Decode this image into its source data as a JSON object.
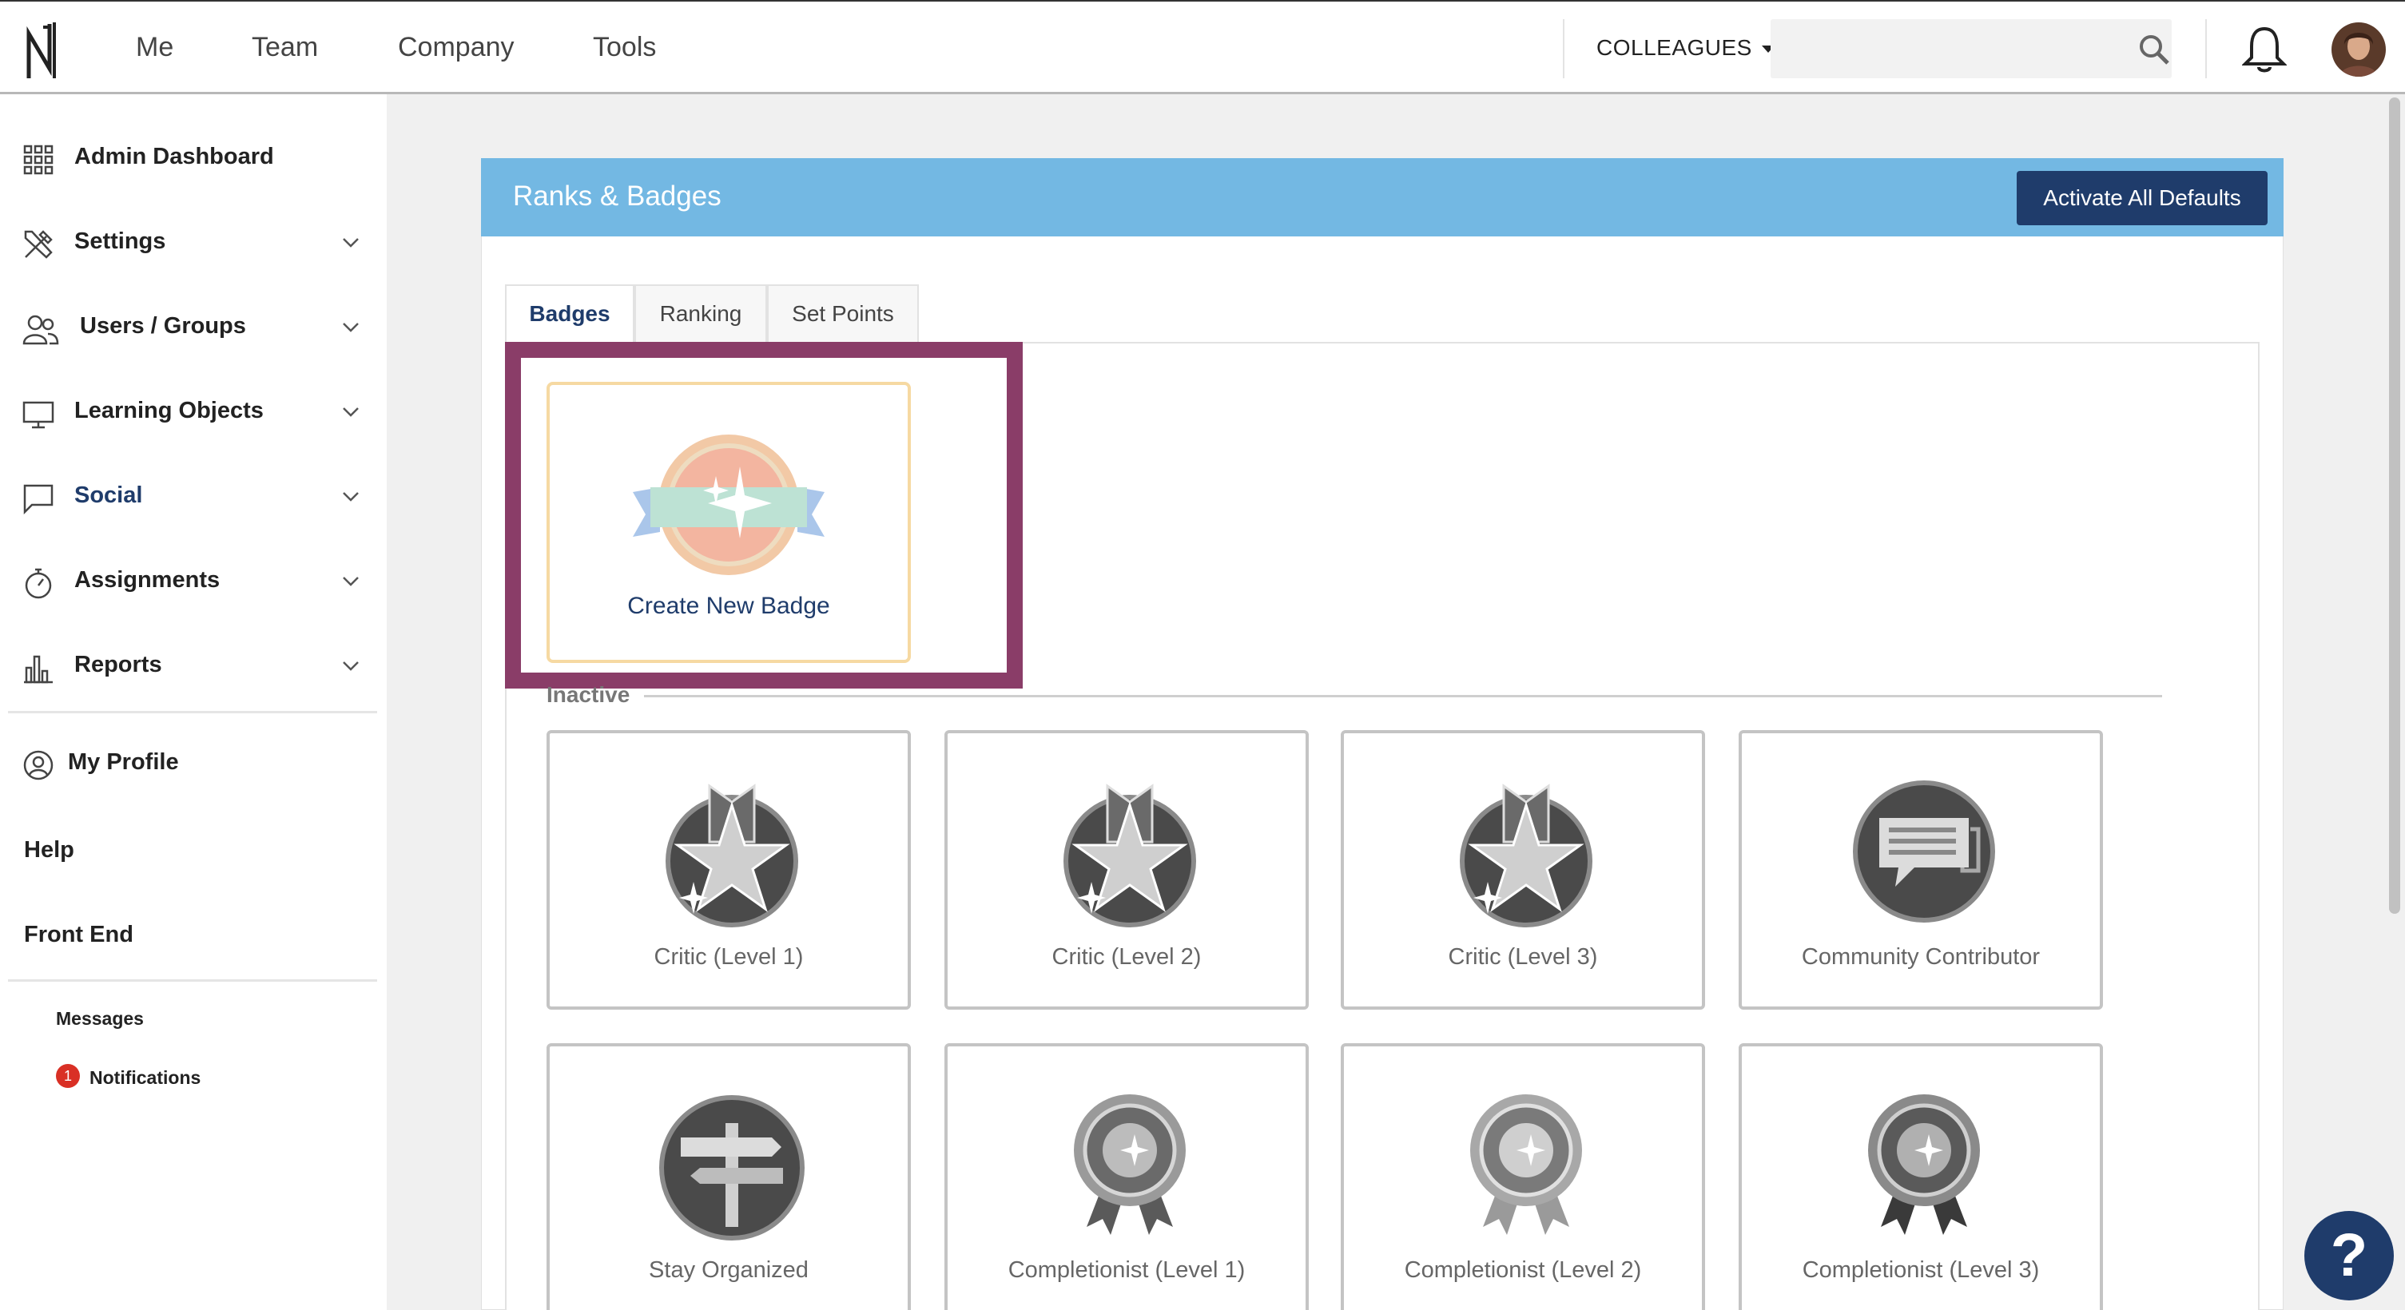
{
  "nav": {
    "links": [
      "Me",
      "Team",
      "Company",
      "Tools"
    ],
    "colleagues_label": "COLLEAGUES",
    "search_placeholder": ""
  },
  "sidebar": {
    "items": [
      {
        "label": "Admin Dashboard",
        "icon": "grid-icon",
        "expandable": false
      },
      {
        "label": "Settings",
        "icon": "tools-icon",
        "expandable": true
      },
      {
        "label": "Users / Groups",
        "icon": "users-icon",
        "expandable": true
      },
      {
        "label": "Learning Objects",
        "icon": "monitor-icon",
        "expandable": true
      },
      {
        "label": "Social",
        "icon": "chat-icon",
        "expandable": true
      },
      {
        "label": "Assignments",
        "icon": "stopwatch-icon",
        "expandable": true
      },
      {
        "label": "Reports",
        "icon": "bar-chart-icon",
        "expandable": true
      }
    ],
    "my_profile": "My Profile",
    "help": "Help",
    "front_end": "Front End",
    "messages": "Messages",
    "notifications": "Notifications",
    "notifications_count": "1"
  },
  "panel": {
    "title": "Ranks & Badges",
    "activate_button": "Activate All Defaults",
    "tabs": [
      "Badges",
      "Ranking",
      "Set Points"
    ],
    "active_tab": "Badges",
    "create_label": "Create New Badge",
    "section_label": "Inactive",
    "badges": [
      {
        "name": "Critic (Level 1)",
        "icon": "critic-star-icon"
      },
      {
        "name": "Critic (Level 2)",
        "icon": "critic-star-icon"
      },
      {
        "name": "Critic (Level 3)",
        "icon": "critic-star-icon"
      },
      {
        "name": "Community Contributor",
        "icon": "speech-bubble-icon"
      },
      {
        "name": "Stay Organized",
        "icon": "signpost-icon"
      },
      {
        "name": "Completionist (Level 1)",
        "icon": "rosette-icon"
      },
      {
        "name": "Completionist (Level 2)",
        "icon": "rosette-icon"
      },
      {
        "name": "Completionist (Level 3)",
        "icon": "rosette-icon"
      }
    ]
  },
  "help_button": "?",
  "colors": {
    "header_blue": "#73b8e3",
    "navy": "#1f3c6b",
    "highlight": "#8a3d68",
    "create_border": "#f6d9a2",
    "badge_grey": "#c4c4c4"
  }
}
